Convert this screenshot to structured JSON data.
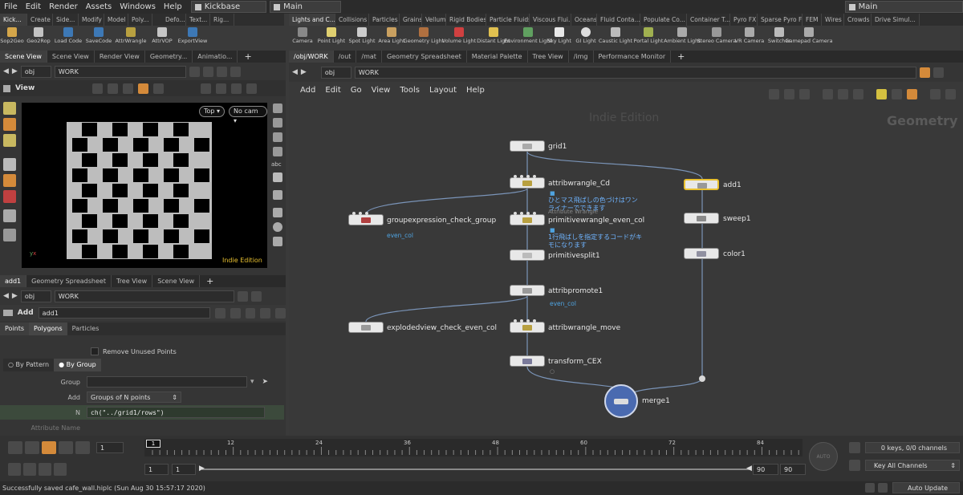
{
  "menu": [
    "File",
    "Edit",
    "Render",
    "Assets",
    "Windows",
    "Help"
  ],
  "desktop": "Kickbase",
  "desktop_options": "Main",
  "right_desktop": "Main",
  "left_shelf_tabs": [
    "Kick...",
    "Create",
    "Side...",
    "Modify",
    "Model",
    "Poly...",
    "Defo...",
    "Text...",
    "Rig..."
  ],
  "left_tools": [
    "Sop2Geo",
    "Geo2Rop",
    "Load Code",
    "SaveCode",
    "AttrWrangle",
    "AttrVOP",
    "ExportView"
  ],
  "right_shelf_tabs": [
    "Lights and C...",
    "Collisions",
    "Particles",
    "Grains",
    "Vellum",
    "Rigid Bodies",
    "Particle Fluids",
    "Viscous Flui...",
    "Oceans",
    "Fluid Conta...",
    "Populate Co...",
    "Container T...",
    "Pyro FX",
    "Sparse Pyro FX",
    "FEM",
    "Wires",
    "Crowds",
    "Drive Simul..."
  ],
  "right_tools": [
    "Camera",
    "Point Light",
    "Spot Light",
    "Area Light",
    "Geometry Light",
    "Volume Light",
    "Distant Light",
    "Environment Light",
    "Sky Light",
    "GI Light",
    "Caustic Light",
    "Portal Light",
    "Ambient Light",
    "Stereo Camera",
    "VR Camera",
    "Switcher",
    "Gamepad Camera"
  ],
  "viewer": {
    "tabs": [
      "Scene View",
      "Scene View",
      "Render View",
      "Geometry...",
      "Animatio..."
    ],
    "path_obj": "obj",
    "path_work": "WORK",
    "title": "View",
    "top_btn": "Top",
    "cam_btn": "No cam",
    "watermark": "Indie Edition",
    "side_label": "abc"
  },
  "params": {
    "tabs": [
      "add1",
      "Geometry Spreadsheet",
      "Tree View",
      "Scene View"
    ],
    "path_obj": "obj",
    "path_work": "WORK",
    "node_type": "Add",
    "node_name": "add1",
    "subtabs": [
      "Points",
      "Polygons",
      "Particles"
    ],
    "remove_unused": "Remove Unused Points",
    "by_pattern": "By Pattern",
    "by_group": "By Group",
    "group_label": "Group",
    "add_label": "Add",
    "add_value": "Groups of N points",
    "n_label": "N",
    "n_value": "ch(\"../grid1/rows\")",
    "attr_label": "Attribute Name"
  },
  "network": {
    "tabs": [
      "/obj/WORK",
      "/out",
      "/mat",
      "Geometry Spreadsheet",
      "Material Palette",
      "Tree View",
      "/img",
      "Performance Monitor"
    ],
    "path_obj": "obj",
    "path_work": "WORK",
    "menu": [
      "Add",
      "Edit",
      "Go",
      "View",
      "Tools",
      "Layout",
      "Help"
    ],
    "watermark": "Indie Edition",
    "context": "Geometry",
    "nodes": {
      "grid1": "grid1",
      "attribwrangle_cd": "attribwrangle_Cd",
      "primitivewrangle": "primitivewrangle_even_col",
      "primitivewrangle_type": "Attribute Wrangle",
      "primitivesplit": "primitivesplit1",
      "attribpromote": "attribpromote1",
      "attribwrangle_move": "attribwrangle_move",
      "transform": "transform_CEX",
      "merge": "merge1",
      "groupexpr": "groupexpression_check_group",
      "explodedview": "explodedview_check_even_col",
      "add1": "add1",
      "sweep1": "sweep1",
      "color1": "color1"
    },
    "subs": {
      "groupexpr": "even_col",
      "attribpromote": "even_col"
    },
    "notes": {
      "cd_1": "ひとマス飛ばしの色づけはワン",
      "cd_2": "ライナーでできます",
      "pw_1": "1行飛ばしを指定するコードがキ",
      "pw_2": "モになります"
    }
  },
  "timeline": {
    "frame": "1",
    "ticks": [
      "12",
      "24",
      "36",
      "48",
      "60",
      "72",
      "84"
    ],
    "range_start": "1",
    "range_start2": "1",
    "range_end": "90",
    "range_end2": "90",
    "channels": "0 keys, 0/0 channels",
    "key_all": "Key All Channels",
    "auto_update": "Auto Update",
    "auto_btn": "AUTO"
  },
  "status": "Successfully saved cafe_wall.hiplc (Sun Aug 30 15:57:17 2020)"
}
